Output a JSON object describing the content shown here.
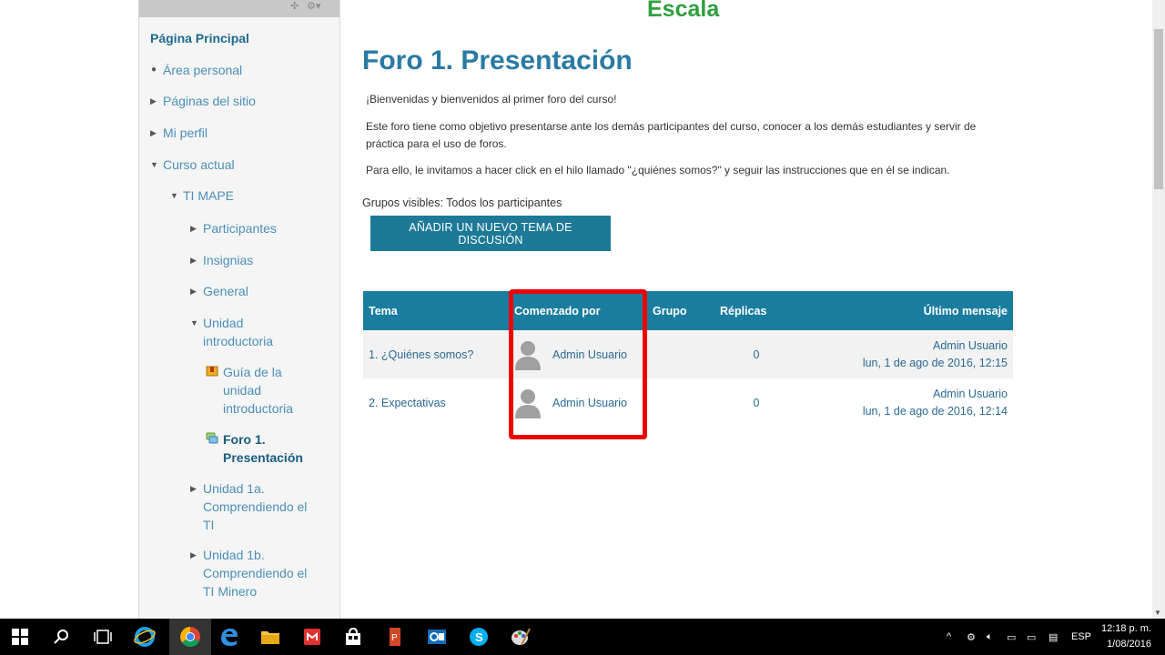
{
  "top_heading": "Escala",
  "sidebar": {
    "home": "Página Principal",
    "items": [
      {
        "label": "Área personal"
      },
      {
        "label": "Páginas del sitio"
      },
      {
        "label": "Mi perfil"
      },
      {
        "label": "Curso actual"
      },
      {
        "label": "TI MAPE"
      },
      {
        "label": "Participantes"
      },
      {
        "label": "Insignias"
      },
      {
        "label": "General"
      },
      {
        "label": "Unidad introductoria"
      },
      {
        "label": "Guía de la unidad introductoria"
      },
      {
        "label": "Foro 1. Presentación"
      },
      {
        "label": "Unidad 1a. Comprendiendo el TI"
      },
      {
        "label": "Unidad 1b. Comprendiendo el TI Minero"
      }
    ]
  },
  "main": {
    "title": "Foro 1. Presentación",
    "paragraphs": [
      "¡Bienvenidas y bienvenidos al primer foro del curso!",
      "Este foro tiene como objetivo presentarse ante los demás participantes del curso, conocer a los demás estudiantes y servir de práctica para el uso de foros.",
      "Para ello, le invitamos a hacer click en el hilo llamado \"¿quiénes somos?\" y seguir las instrucciones que en él se indican."
    ],
    "groups_label": "Grupos visibles: Todos los participantes",
    "add_button": "AÑADIR UN NUEVO TEMA DE DISCUSIÓN"
  },
  "table": {
    "headers": [
      "Tema",
      "Comenzado por",
      "Grupo",
      "Réplicas",
      "Último mensaje"
    ],
    "rows": [
      {
        "topic": "1. ¿Quiénes somos?",
        "author": "Admin Usuario",
        "group": "",
        "replies": "0",
        "last_user": "Admin Usuario",
        "last_date": "lun, 1 de ago de 2016, 12:15"
      },
      {
        "topic": "2. Expectativas",
        "author": "Admin Usuario",
        "group": "",
        "replies": "0",
        "last_user": "Admin Usuario",
        "last_date": "lun, 1 de ago de 2016, 12:14"
      }
    ]
  },
  "taskbar": {
    "language": "ESP",
    "time": "12:18 p. m.",
    "date": "1/08/2016"
  },
  "colors": {
    "accent": "#1a7da0",
    "title": "#2a7aa3",
    "highlight": "#ee0000",
    "heading_green": "#2f9f3f"
  }
}
